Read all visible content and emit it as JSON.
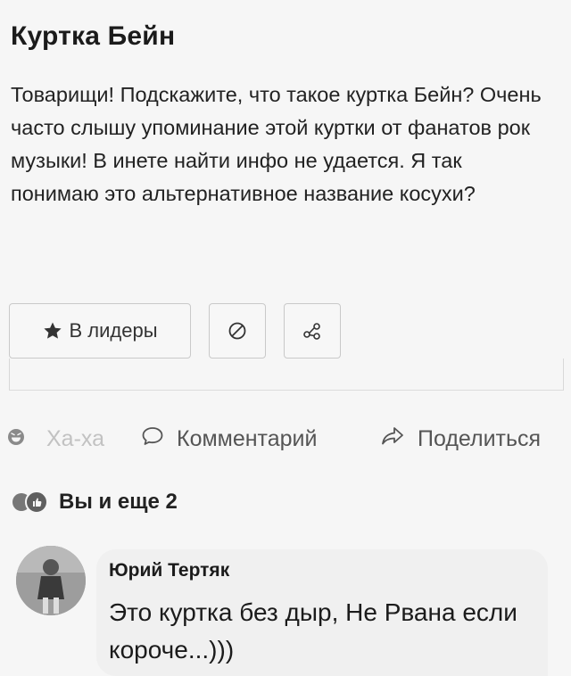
{
  "question": {
    "title": "Куртка Бейн",
    "body": "Товарищи! Подскажите, что такое куртка Бейн? Очень часто слышу упоминание этой куртки от фанатов рок музыки! В инете найти инфо не удается. Я так понимаю это альтернативное название косухи?"
  },
  "buttons": {
    "leaders_label": "В лидеры",
    "leaders_icon": "star-icon",
    "block_icon": "block-icon",
    "share_icon": "share-icon"
  },
  "actions": {
    "haha_label": "Ха-ха",
    "comment_label": "Комментарий",
    "share_label": "Поделиться"
  },
  "reactions": {
    "summary": "Вы и еще 2",
    "icons": [
      "haha-reaction-icon",
      "like-reaction-icon"
    ]
  },
  "comment": {
    "author": "Юрий Тертяк",
    "text": "Это куртка без дыр, Не Рвана если короче...)))"
  },
  "colors": {
    "background": "#f6f6f6",
    "bubble": "#f0f0f0",
    "text": "#1b1b1b",
    "muted": "#c2c2c2"
  }
}
